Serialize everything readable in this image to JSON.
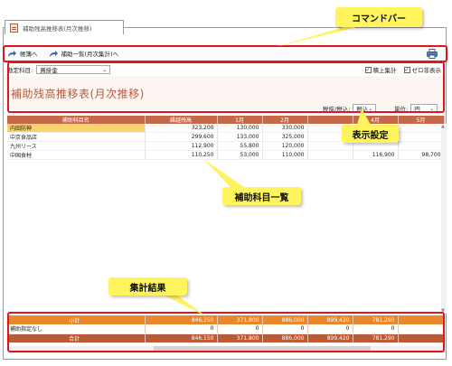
{
  "window": {
    "tab_title": "補助残高推移表(月次推移)"
  },
  "toolbar": {
    "back_label": "帳簿へ",
    "forward_label": "補助一覧(月次集計)へ"
  },
  "filter": {
    "account_label": "勘定科目:",
    "account_value": "買掛金",
    "cumulative_label": "積上集計",
    "cumulative_checked": true,
    "zero_label": "ゼロ非表示",
    "zero_checked": true
  },
  "report": {
    "title": "補助残高推移表(月次推移)",
    "tax_label": "税抜/税込:",
    "tax_value": "税込",
    "unit_label": "単位:",
    "unit_value": "円"
  },
  "grid": {
    "headers": [
      "補助科目名",
      "繰越残高",
      "1月",
      "2月",
      "",
      "4月",
      "5月"
    ],
    "rows": [
      [
        "内田防神",
        "323,200",
        "130,000",
        "330,000",
        "",
        "",
        ""
      ],
      [
        "中京食品店",
        "299,600",
        "133,000",
        "325,000",
        "",
        "",
        ""
      ],
      [
        "九州リース",
        "112,900",
        "55,800",
        "120,000",
        "",
        "",
        ""
      ],
      [
        "中国食材",
        "110,250",
        "53,000",
        "110,000",
        "",
        "116,900",
        "98,700"
      ]
    ]
  },
  "totals": {
    "subtotal_label": "小計",
    "subtotal_values": [
      "846,150",
      "371,800",
      "886,000",
      "899,420",
      "781,290"
    ],
    "none_label": "補助指定なし",
    "none_values": [
      "0",
      "0",
      "0",
      "0",
      "0"
    ],
    "total_label": "合計",
    "total_values": [
      "846,150",
      "371,800",
      "886,000",
      "899,420",
      "781,290"
    ]
  },
  "annotations": {
    "command_bar": "コマンドバー",
    "display_settings": "表示設定",
    "subaccount_list": "補助科目一覧",
    "totals_result": "集計結果",
    "callout_color": "#fff35e",
    "box_color": "#e2151c"
  }
}
